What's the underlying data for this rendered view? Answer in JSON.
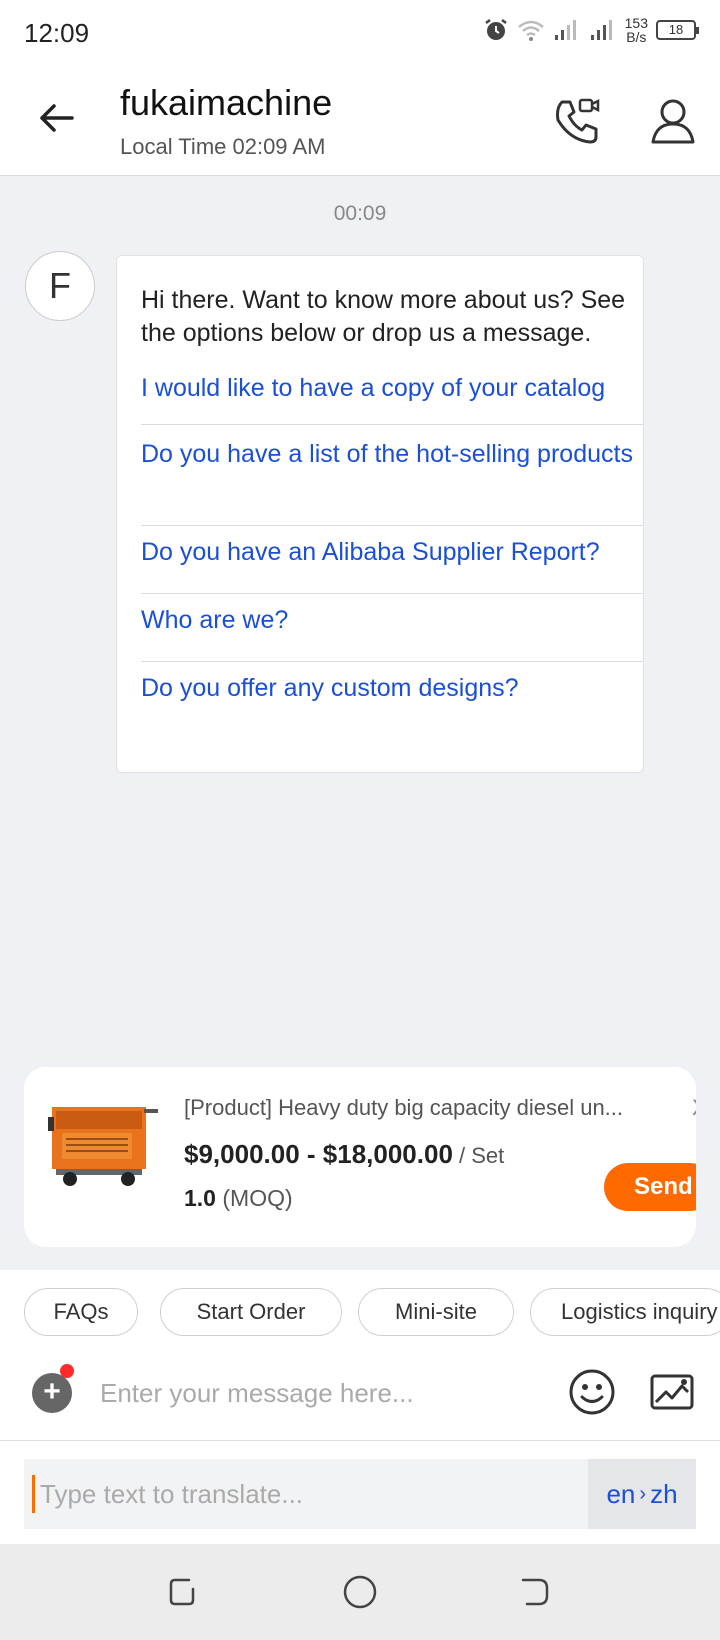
{
  "status_bar": {
    "time": "12:09",
    "net_speed_value": "153",
    "net_speed_unit": "B/s",
    "battery": "18"
  },
  "header": {
    "title": "fukaimachine",
    "subtitle": "Local Time 02:09 AM"
  },
  "chat": {
    "timestamp": "00:09",
    "avatar_letter": "F",
    "message_line1": "Hi there. Want to know more about us? See",
    "message_line2": "the options below or drop us a message.",
    "options": [
      " I would like to have a copy of your catalog",
      "Do you have a list of the hot-selling products",
      "Do you have an Alibaba Supplier Report?",
      "Who are we?",
      "Do you offer any custom designs?"
    ]
  },
  "product": {
    "title": "[Product] Heavy duty big capacity diesel un...",
    "price": "$9,000.00 - $18,000.00",
    "unit": " / Set",
    "moq_value": "1.0",
    "moq_label": " (MOQ)",
    "close": "X",
    "send_label": "Send"
  },
  "quick_replies": [
    "FAQs",
    "Start Order",
    "Mini-site",
    "Logistics inquiry"
  ],
  "composer": {
    "placeholder": "Enter your message here...",
    "plus": "+"
  },
  "translate": {
    "placeholder": "Type text to translate...",
    "source_lang": "en",
    "arrow": "›",
    "target_lang": "zh"
  },
  "colors": {
    "accent": "#ff6a00",
    "link": "#1a4fd6",
    "background": "#f0f1f5"
  }
}
